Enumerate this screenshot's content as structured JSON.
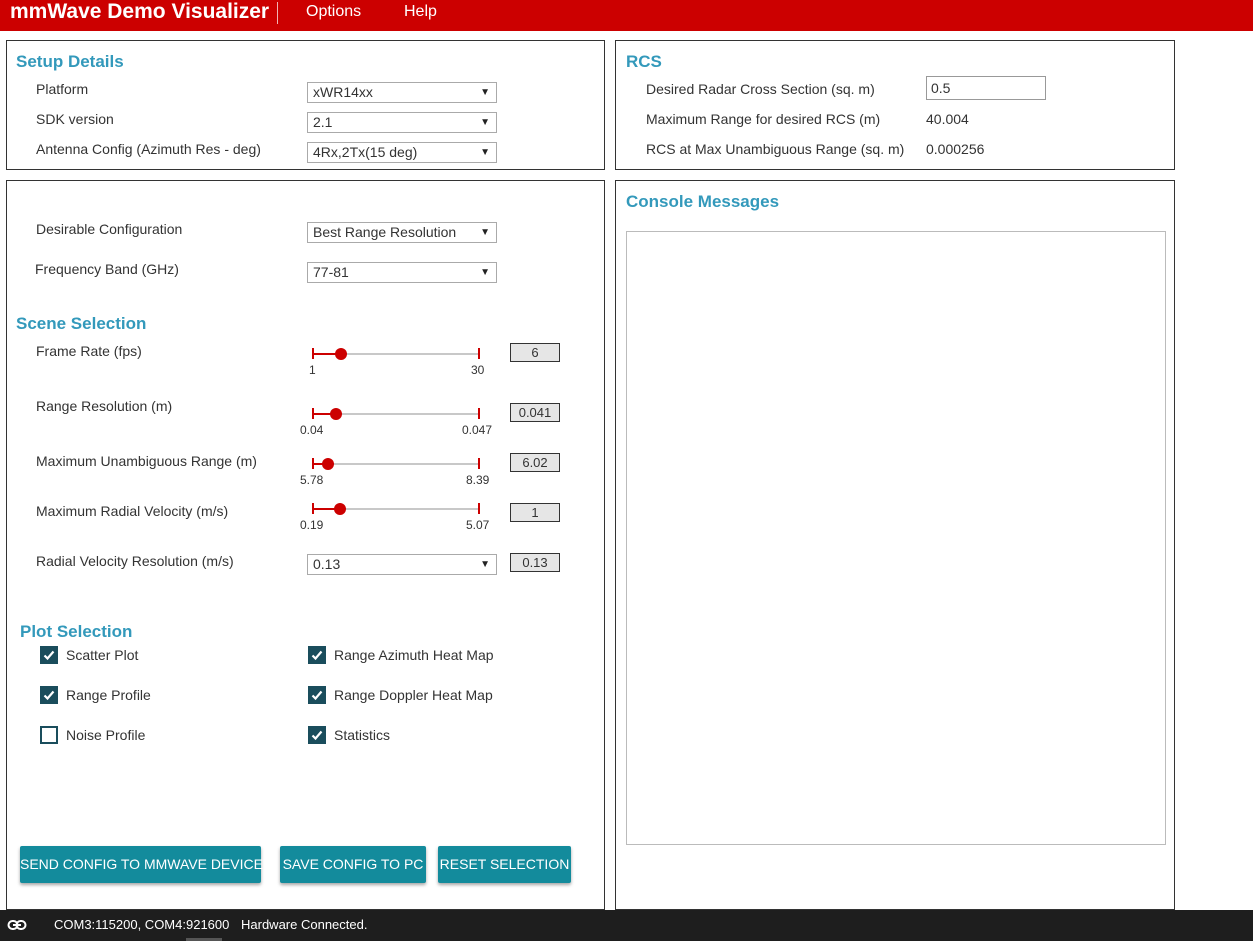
{
  "app": {
    "title": "mmWave Demo Visualizer",
    "menu": [
      "Options",
      "Help"
    ]
  },
  "setup": {
    "title": "Setup Details",
    "platform_label": "Platform",
    "platform_value": "xWR14xx",
    "sdk_label": "SDK version",
    "sdk_value": "2.1",
    "antenna_label": "Antenna Config (Azimuth Res - deg)",
    "antenna_value": "4Rx,2Tx(15 deg)"
  },
  "rcs": {
    "title": "RCS",
    "desired_label": "Desired Radar Cross Section (sq. m)",
    "desired_value": "0.5",
    "max_range_label": "Maximum Range for desired RCS (m)",
    "max_range_value": "40.004",
    "rcs_at_max_label": "RCS at Max Unambiguous Range (sq. m)",
    "rcs_at_max_value": "0.000256"
  },
  "config": {
    "desirable_label": "Desirable Configuration",
    "desirable_value": "Best Range Resolution",
    "freq_label": "Frequency Band (GHz)",
    "freq_value": "77-81"
  },
  "scene": {
    "title": "Scene Selection",
    "sliders": [
      {
        "label": "Frame Rate (fps)",
        "min": "1",
        "max": "30",
        "value": "6",
        "fraction": 0.17
      },
      {
        "label": "Range Resolution (m)",
        "min": "0.04",
        "max": "0.047",
        "value": "0.041",
        "fraction": 0.14
      },
      {
        "label": "Maximum Unambiguous Range (m)",
        "min": "5.78",
        "max": "8.39",
        "value": "6.02",
        "fraction": 0.09
      },
      {
        "label": "Maximum Radial Velocity (m/s)",
        "min": "0.19",
        "max": "5.07",
        "value": "1",
        "fraction": 0.16
      }
    ],
    "velocity_res_label": "Radial Velocity Resolution (m/s)",
    "velocity_res_value": "0.13",
    "velocity_res_readout": "0.13"
  },
  "plots": {
    "title": "Plot Selection",
    "items": [
      {
        "label": "Scatter Plot",
        "checked": true
      },
      {
        "label": "Range Azimuth Heat Map",
        "checked": true
      },
      {
        "label": "Range Profile",
        "checked": true
      },
      {
        "label": "Range Doppler Heat Map",
        "checked": true
      },
      {
        "label": "Noise Profile",
        "checked": false
      },
      {
        "label": "Statistics",
        "checked": true
      }
    ]
  },
  "buttons": {
    "send": "SEND CONFIG TO MMWAVE DEVICE",
    "save": "SAVE CONFIG TO PC",
    "reset": "RESET SELECTION"
  },
  "console": {
    "title": "Console Messages"
  },
  "status": {
    "ports": "COM3:115200, COM4:921600",
    "connection": "Hardware Connected."
  },
  "colors": {
    "brand": "#cc0000",
    "accent": "#3399bb",
    "button": "#138b9c",
    "checkbox": "#1a4d5c"
  },
  "icons": {
    "status_icon": "link-icon"
  }
}
